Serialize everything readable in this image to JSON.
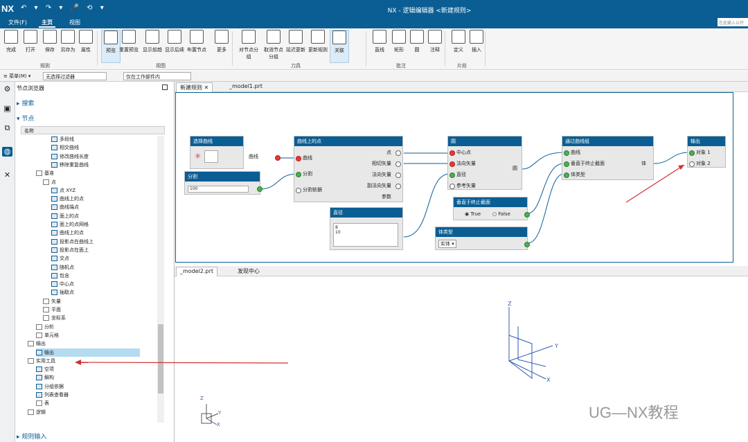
{
  "app": {
    "logo": "NX",
    "title": "NX - 逻辑编辑器 <新建规则>",
    "quick_access": "↶ ▾ ↷ ▾ 🎤 ⟲ ▾"
  },
  "menu": {
    "file": "文件(F)",
    "home": "主页",
    "view": "视图",
    "search_placeholder": "在此输入以开"
  },
  "ribbon": {
    "buttons": [
      "完成",
      "打开",
      "保存",
      "另存为",
      "属性",
      "预览",
      "重置预览",
      "显示前趋",
      "显示后续",
      "布置节点",
      "更多",
      "对节点分组",
      "取消节点分组",
      "延迟更新",
      "更新规则",
      "关联",
      "直线",
      "矩形",
      "圆",
      "注释",
      "定义",
      "插入"
    ],
    "groups": [
      "规则",
      "视图",
      "刀具",
      "批注",
      "片段"
    ]
  },
  "toolbar2": {
    "menu": "≡ 菜单(M) ▾",
    "filter": "无选择过滤器",
    "scope": "仅在工作部件内"
  },
  "nav": {
    "title": "节点浏览器",
    "search": "搜索",
    "nodes": "节点",
    "col_name": "名称",
    "rule_input": "规则输入",
    "items": [
      "多段线",
      "相交曲线",
      "修改曲线长度",
      "移除重复曲线",
      "基准",
      "点",
      "点 XYZ",
      "曲线上的点",
      "曲线端点",
      "面上的点",
      "面上的点网格",
      "曲线上的点",
      "投影点在曲线上",
      "投影点在面上",
      "交点",
      "随机点",
      "包含",
      "中心点",
      "抽取点",
      "矢量",
      "平面",
      "坐标系",
      "分析",
      "单元格",
      "输出",
      "输出",
      "实用工具",
      "空项",
      "解构",
      "分组依据",
      "列表查看器",
      "表",
      "逻辑"
    ]
  },
  "tabs": {
    "top": [
      "新建规则",
      "_model1.prt"
    ],
    "bottom": [
      "_model2.prt",
      "发现中心"
    ]
  },
  "nodes": {
    "select_curve": {
      "title": "选择曲线",
      "out": "曲线"
    },
    "point_on_curve": {
      "title": "曲线上的点",
      "in": [
        "曲线",
        "分割",
        "分割依据"
      ],
      "out": [
        "点",
        "相切矢量",
        "法向矢量",
        "副法向矢量",
        "参数"
      ]
    },
    "split": {
      "title": "分割",
      "value": "100"
    },
    "diameter": {
      "title": "直径",
      "values": "8\n10"
    },
    "circle": {
      "title": "圆",
      "in": [
        "中心点",
        "法向矢量",
        "直径",
        "参考矢量"
      ],
      "out": "圆"
    },
    "perp_end": {
      "title": "垂直于终止截面",
      "true": "True",
      "false": "False"
    },
    "body_type": {
      "title": "体类型",
      "value": "实体 ▾"
    },
    "through_curves": {
      "title": "通过曲线组",
      "in": [
        "曲线",
        "垂直于终止截面",
        "体类型"
      ],
      "out": "体"
    },
    "output": {
      "title": "输出",
      "in": [
        "对象 1",
        "对象 2"
      ]
    }
  },
  "axes": {
    "x": "X",
    "y": "Y",
    "z": "Z"
  },
  "watermark": "UG—NX教程"
}
